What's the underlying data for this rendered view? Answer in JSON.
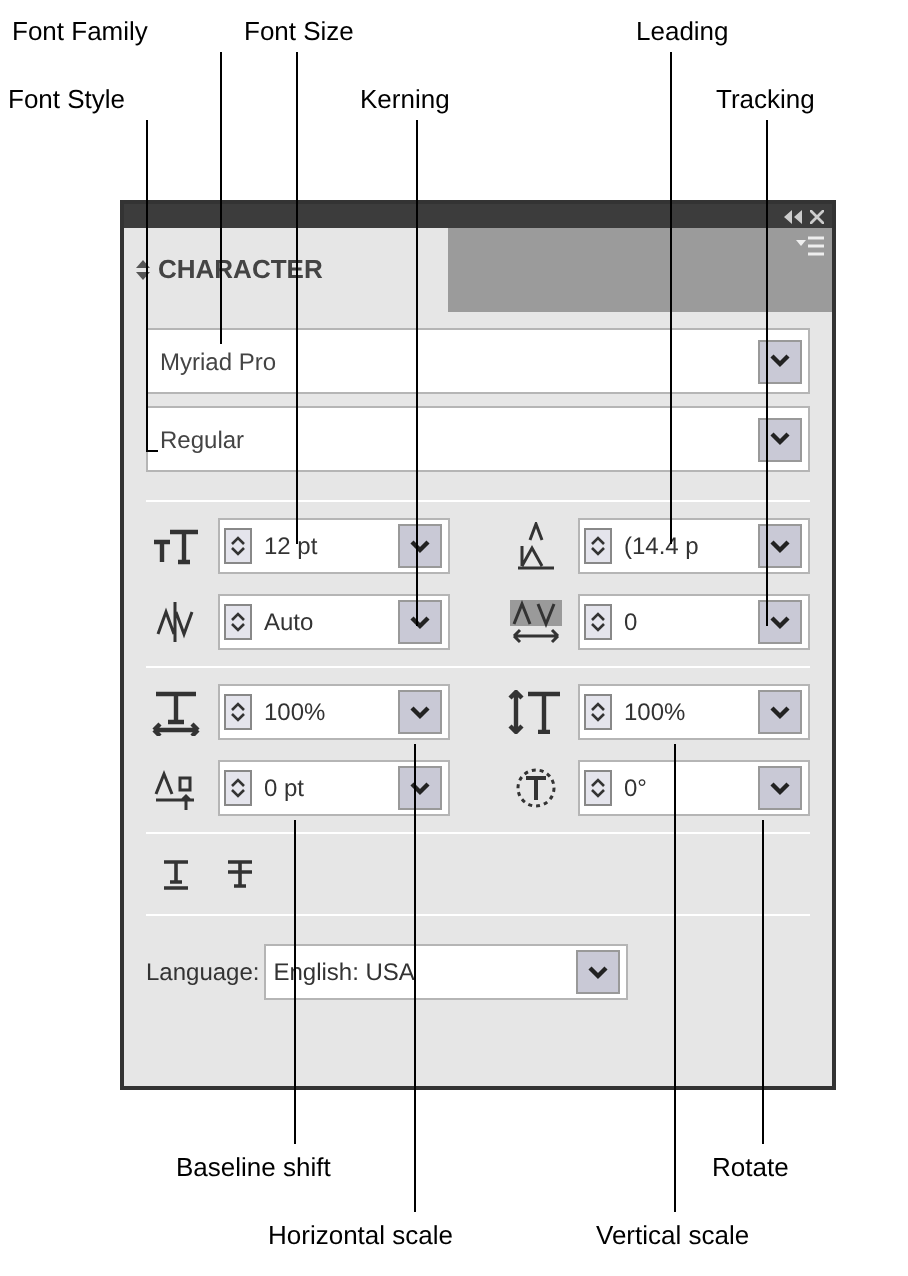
{
  "callouts_top": [
    {
      "text": "Font Family"
    },
    {
      "text": "Font Size"
    },
    {
      "text": "Leading"
    },
    {
      "text": "Font Style"
    },
    {
      "text": "Kerning"
    },
    {
      "text": "Tracking"
    }
  ],
  "callouts_bottom": [
    {
      "text": "Baseline shift"
    },
    {
      "text": "Rotate"
    },
    {
      "text": "Horizontal scale"
    },
    {
      "text": "Vertical scale"
    }
  ],
  "panel": {
    "tab": {
      "label": "CHARACTER",
      "selected": true
    },
    "font_family": {
      "value": "Myriad Pro"
    },
    "font_style": {
      "value": "Regular"
    },
    "field_groups": [
      [
        {
          "kind": "size",
          "value": "12 pt"
        },
        {
          "kind": "leading",
          "value": "(14.4 p"
        },
        {
          "kind": "kerning",
          "value": "Auto"
        },
        {
          "kind": "tracking",
          "value": "0"
        }
      ],
      [
        {
          "kind": "hscale",
          "value": "100%"
        },
        {
          "kind": "vscale",
          "value": "100%"
        },
        {
          "kind": "baseline",
          "value": "0 pt"
        },
        {
          "kind": "rotate",
          "value": "0°"
        }
      ]
    ],
    "language": {
      "label": "Language:",
      "value": "English: USA"
    }
  }
}
